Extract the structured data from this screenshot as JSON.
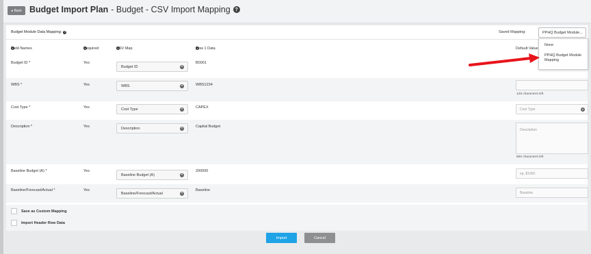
{
  "header": {
    "back_label": "Back",
    "title_bold": "Budget Import Plan",
    "title_sub": "- Budget - CSV Import Mapping"
  },
  "mapping": {
    "label": "Budget Module Data Mapping:",
    "saved_label": "Saved Mapping:",
    "saved_value": "PPHQ Budget Module...",
    "options": [
      "None",
      "PPHQ Budget Module Mapping"
    ]
  },
  "columns": {
    "field_names": "Field Names",
    "required": "Required",
    "csv_map": "CSV Map",
    "row1": "Row 1 Data",
    "default_value": "Default Value"
  },
  "rows": [
    {
      "field": "Budget ID *",
      "required": "Yes",
      "csv": "Budget ID",
      "row1": "B0001"
    },
    {
      "field": "WBS *",
      "required": "Yes",
      "csv": "WBS",
      "row1": "WBS1234",
      "chars": "128 characters left"
    },
    {
      "field": "Cost Type *",
      "required": "Yes",
      "csv": "Cost Type",
      "row1": "CAPEX",
      "default": "Cost Type"
    },
    {
      "field": "Description *",
      "required": "Yes",
      "csv": "Description",
      "row1": "Capital Budget",
      "default": "Description",
      "chars": "500 characters left"
    },
    {
      "field": "Baseline Budget (A) *",
      "required": "Yes",
      "csv": "Baseline Budget (A)",
      "row1": "200000",
      "default": "eg. $1000"
    },
    {
      "field": "Baseline/Forecast/Actual *",
      "required": "Yes",
      "csv": "Baseline/Forecast/Actual",
      "row1": "Baseline",
      "default": "Baseline"
    }
  ],
  "options": {
    "save_custom": "Save as Custom Mapping",
    "import_header": "Import Header Row Data"
  },
  "buttons": {
    "import": "Import",
    "cancel": "Cancel"
  },
  "colors": {
    "accent": "#1ea3e6",
    "annotation_arrow": "#e8141b"
  }
}
